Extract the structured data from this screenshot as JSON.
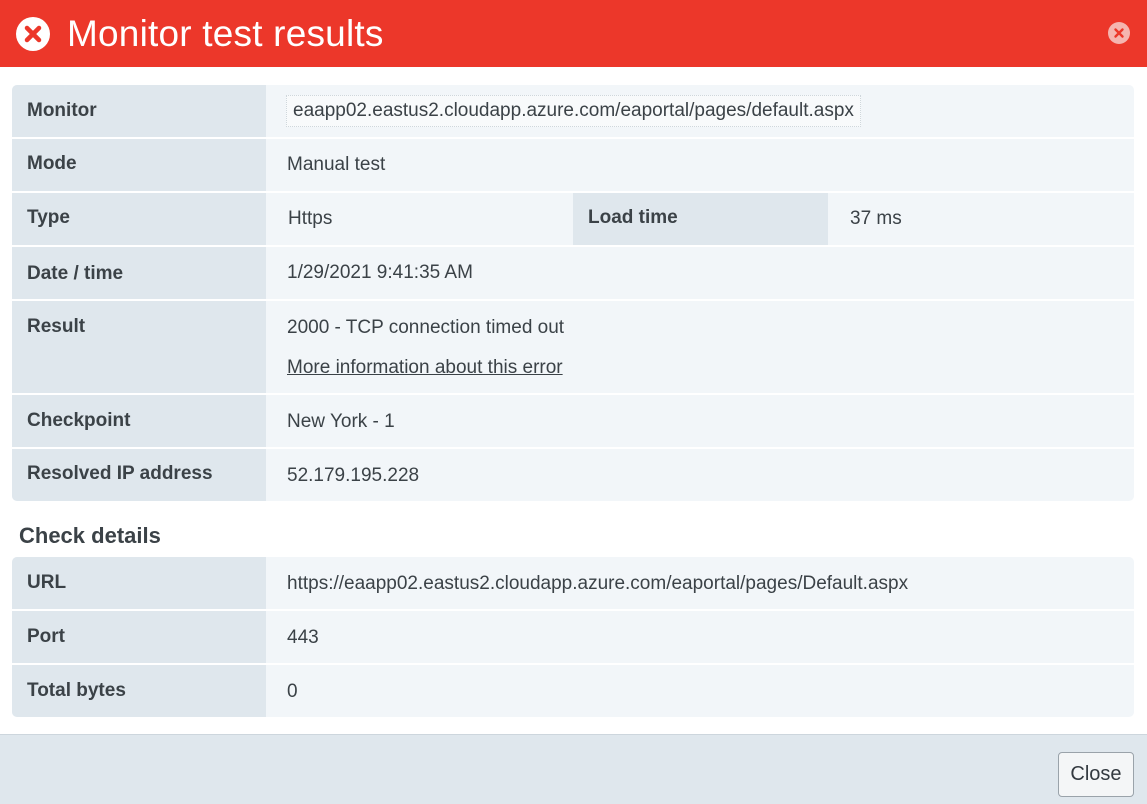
{
  "dialog": {
    "title": "Monitor test results",
    "colors": {
      "header": "#ec372a",
      "label_bg": "#dfe7ed",
      "value_bg": "#f2f6f9"
    },
    "icons": {
      "status": "error-circle-x-icon",
      "close": "close-circle-icon"
    }
  },
  "details": {
    "monitor_label": "Monitor",
    "monitor_value": "eaapp02.eastus2.cloudapp.azure.com/eaportal/pages/default.aspx",
    "mode_label": "Mode",
    "mode_value": "Manual test",
    "type_label": "Type",
    "type_value": "Https",
    "load_time_label": "Load time",
    "load_time_value": "37 ms",
    "datetime_label": "Date / time",
    "datetime_value": "1/29/2021 9:41:35 AM",
    "result_label": "Result",
    "result_value": "2000 - TCP connection timed out",
    "result_link": "More information about this error",
    "checkpoint_label": "Checkpoint",
    "checkpoint_value": "New York - 1",
    "ip_label": "Resolved IP address",
    "ip_value": "52.179.195.228"
  },
  "check_details": {
    "title": "Check details",
    "url_label": "URL",
    "url_value": "https://eaapp02.eastus2.cloudapp.azure.com/eaportal/pages/Default.aspx",
    "port_label": "Port",
    "port_value": "443",
    "bytes_label": "Total bytes",
    "bytes_value": "0"
  },
  "footer": {
    "close_label": "Close"
  }
}
